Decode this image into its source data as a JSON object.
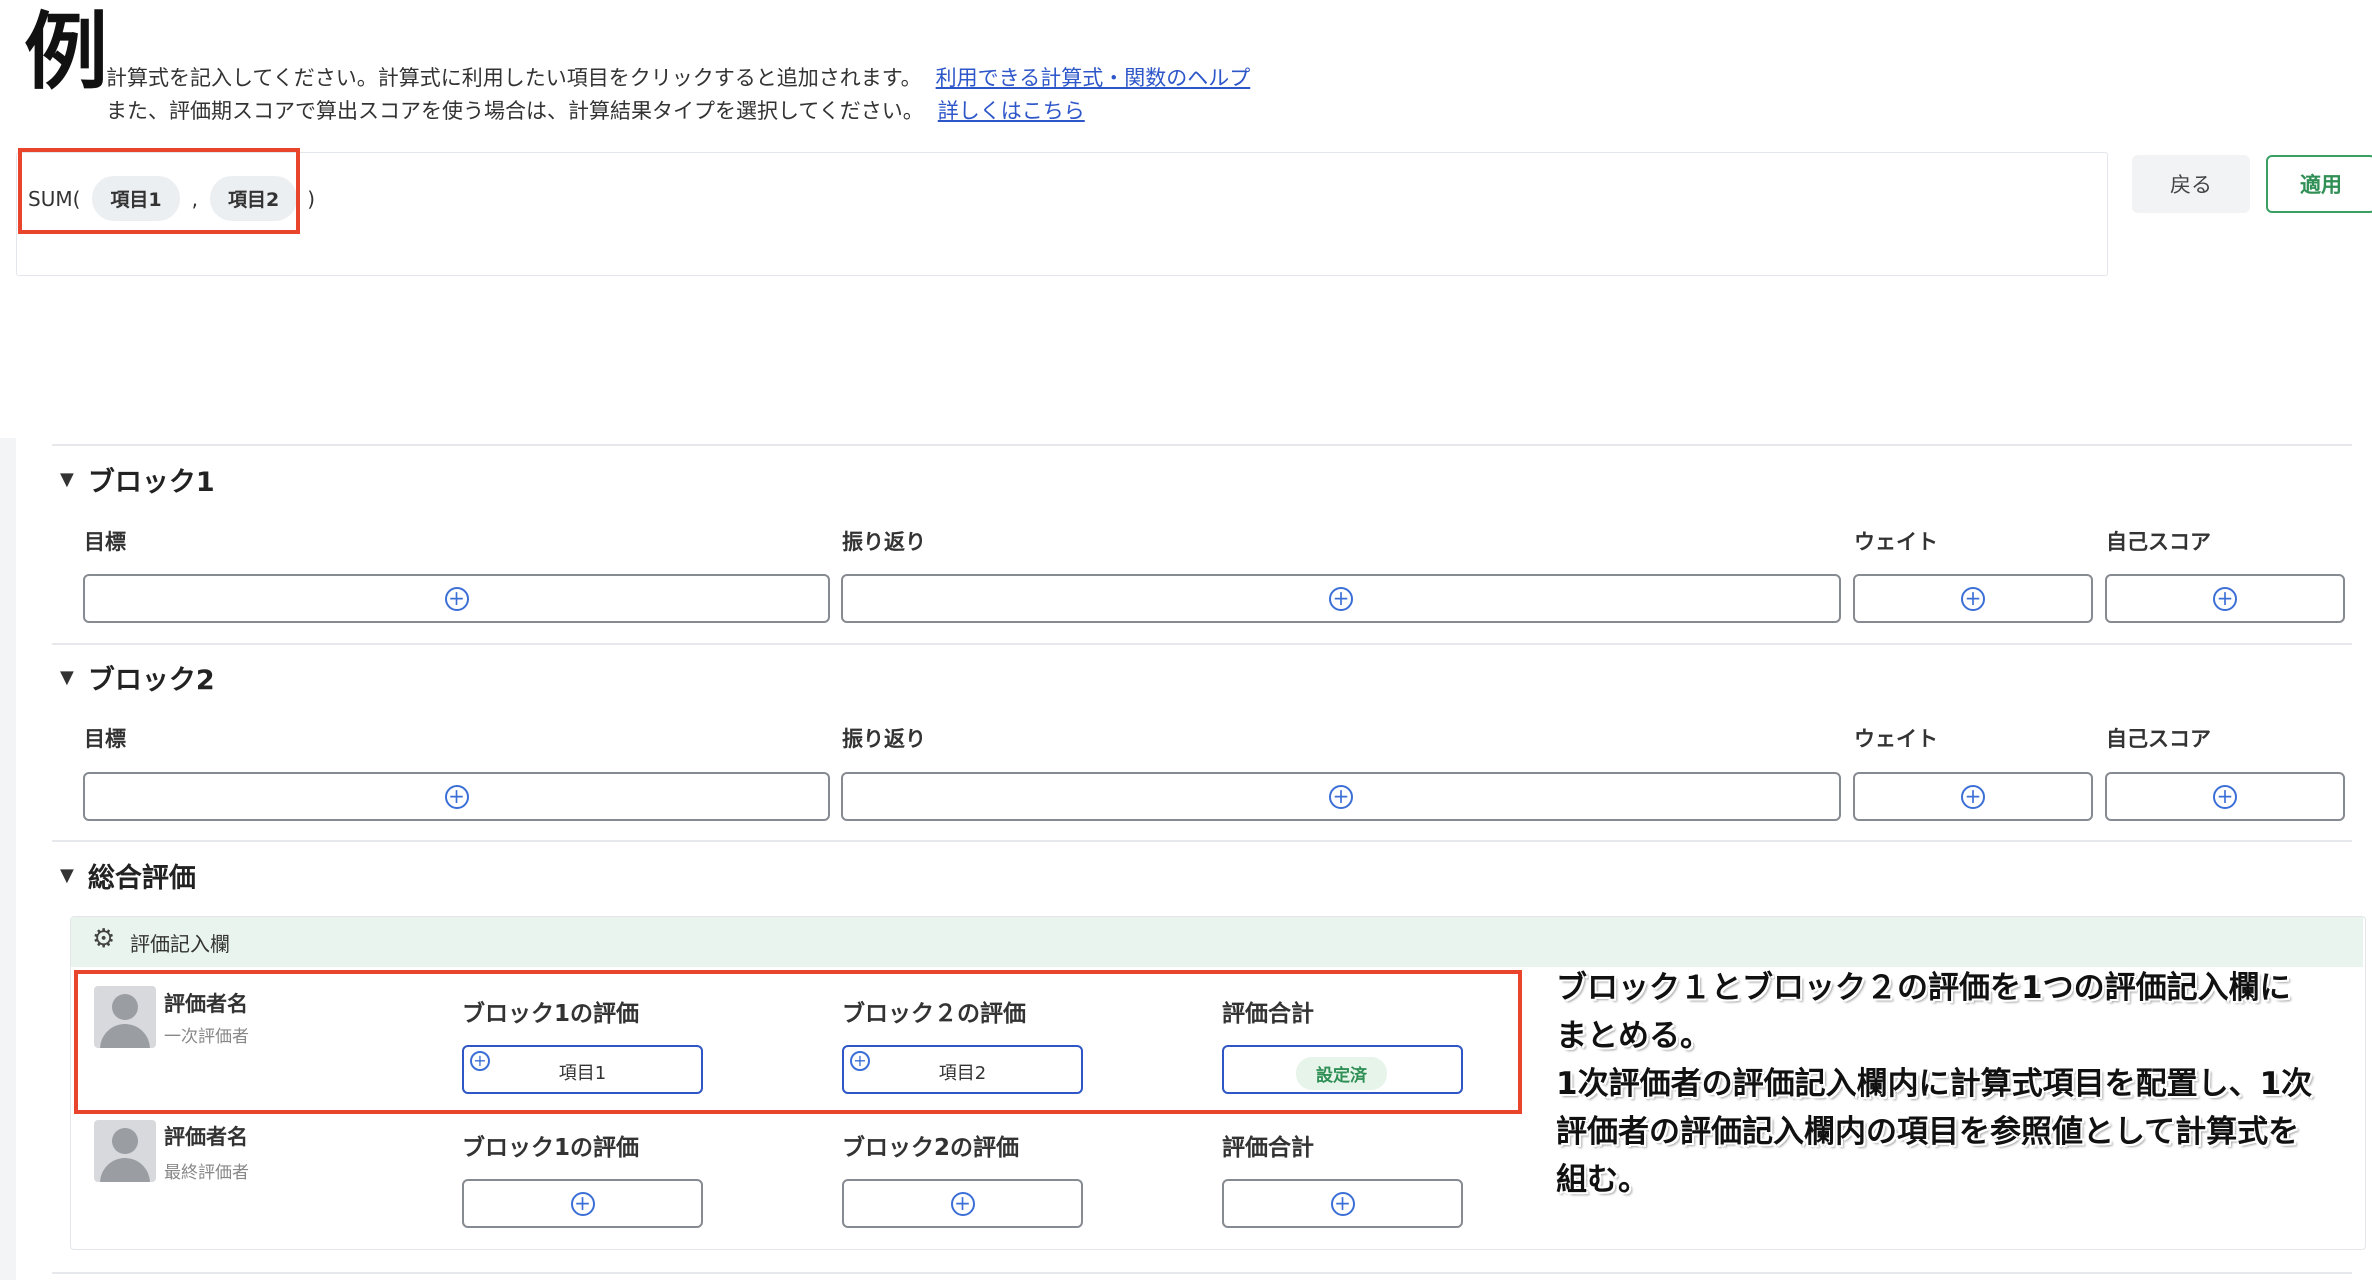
{
  "overlay_label": "例",
  "help": {
    "line1_text": "計算式を記入してください。計算式に利用したい項目をクリックすると追加されます。",
    "line1_link": "利用できる計算式・関数のヘルプ",
    "line2_text": "また、評価期スコアで算出スコアを使う場合は、計算結果タイプを選択してください。",
    "line2_link": "詳しくはこちら"
  },
  "formula": {
    "func_open": "SUM(",
    "item1": "項目1",
    "separator": ",",
    "item2": "項目2",
    "func_close": ")"
  },
  "buttons": {
    "back": "戻る",
    "apply": "適用"
  },
  "blocks": [
    {
      "title": "ブロック1",
      "columns": [
        "目標",
        "振り返り",
        "ウェイト",
        "自己スコア"
      ]
    },
    {
      "title": "ブロック2",
      "columns": [
        "目標",
        "振り返り",
        "ウェイト",
        "自己スコア"
      ]
    }
  ],
  "overall": {
    "title": "総合評価",
    "card_header": "評価記入欄",
    "raters": [
      {
        "name": "評価者名",
        "role": "一次評価者",
        "fields": [
          {
            "label": "ブロック1の評価",
            "value": "項目1"
          },
          {
            "label": "ブロック２の評価",
            "value": "項目2"
          },
          {
            "label": "評価合計",
            "badge": "設定済"
          }
        ]
      },
      {
        "name": "評価者名",
        "role": "最終評価者",
        "fields": [
          {
            "label": "ブロック1の評価"
          },
          {
            "label": "ブロック2の評価"
          },
          {
            "label": "評価合計"
          }
        ]
      }
    ]
  },
  "annotation": {
    "line1": "ブロック１とブロック２の評価を1つの評価記入欄に",
    "line2": "まとめる。",
    "line3": "1次評価者の評価記入欄内に計算式項目を配置し、1次",
    "line4": "評価者の評価記入欄内の項目を参照値として計算式を",
    "line5": "組む。"
  },
  "colors": {
    "accent_blue": "#2e56c7",
    "apply_green": "#2f8f55",
    "highlight_red": "#e8452c"
  }
}
